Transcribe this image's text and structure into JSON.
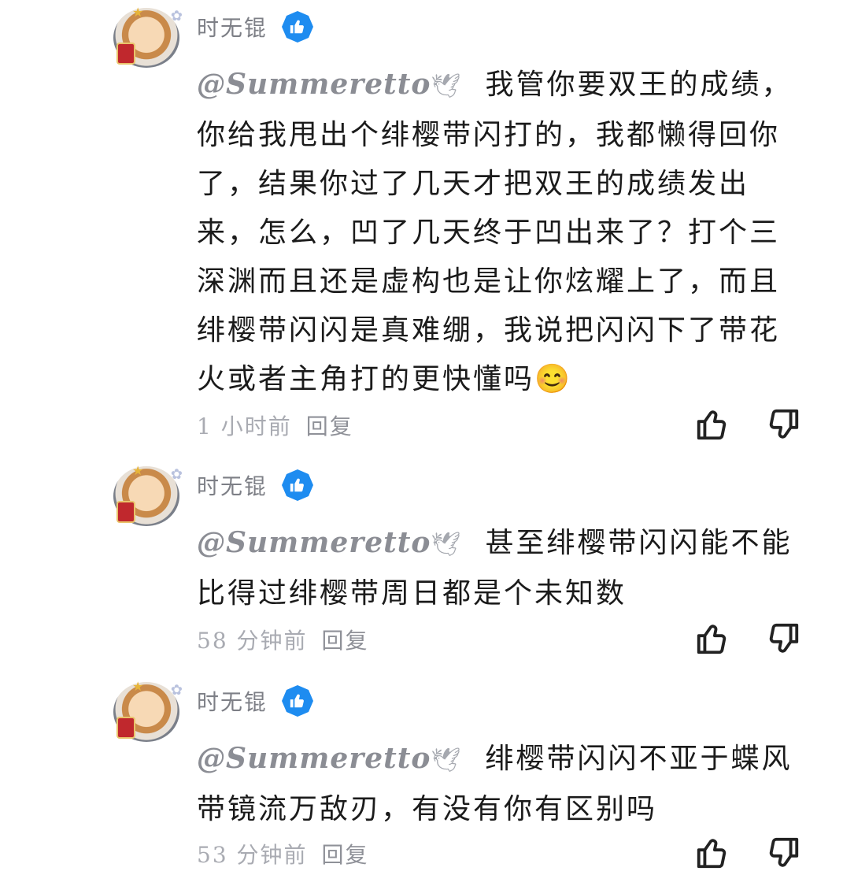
{
  "comments": [
    {
      "username": "时无锟",
      "mention": "@Summeretto",
      "text": "我管你要双王的成绩，你给我甩出个绯樱带闪打的，我都懒得回你了，结果你过了几天才把双王的成绩发出来，怎么，凹了几天终于凹出来了？打个三深渊而且还是虚构也是让你炫耀上了，而且绯樱带闪闪是真难绷，我说把闪闪下了带花火或者主角打的更快懂吗",
      "emoji": "😊",
      "time": "1 小时前",
      "reply": "回复"
    },
    {
      "username": "时无锟",
      "mention": "@Summeretto",
      "text": "甚至绯樱带闪闪能不能比得过绯樱带周日都是个未知数",
      "emoji": "",
      "time": "58 分钟前",
      "reply": "回复"
    },
    {
      "username": "时无锟",
      "mention": "@Summeretto",
      "text": "绯樱带闪闪不亚于蝶风带镜流万敌刃，有没有你有区别吗",
      "emoji": "",
      "time": "53 分钟前",
      "reply": "回复"
    }
  ],
  "icons": {
    "verified": "thumbs-up-badge-icon",
    "like": "thumbs-up-icon",
    "dislike": "thumbs-down-icon",
    "dove": "dove-icon"
  },
  "colors": {
    "verified": "#1e8cf0",
    "text": "#1b1b1b",
    "muted": "#a9abb2"
  }
}
